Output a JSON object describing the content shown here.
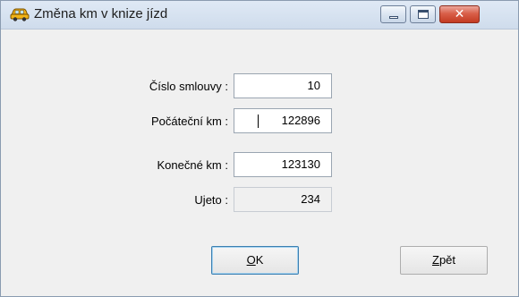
{
  "window": {
    "title": "Změna km v knize jízd",
    "icon": "car-icon",
    "controls": {
      "minimize": "minimize-icon",
      "maximize": "maximize-icon",
      "close": "close-icon",
      "close_glyph": "✕"
    }
  },
  "form": {
    "contract_label": "Číslo smlouvy :",
    "contract_value": "10",
    "start_km_label": "Počáteční km :",
    "start_km_value": "122896",
    "end_km_label": "Konečné km :",
    "end_km_value": "123130",
    "driven_label": "Ujeto :",
    "driven_value": "234"
  },
  "buttons": {
    "ok_mnemonic": "O",
    "ok_rest": "K",
    "back_mnemonic": "Z",
    "back_rest": "pět"
  },
  "colors": {
    "close_button": "#c33a22",
    "window_bg": "#f0f0f0",
    "titlebar": "#cfdcec"
  }
}
